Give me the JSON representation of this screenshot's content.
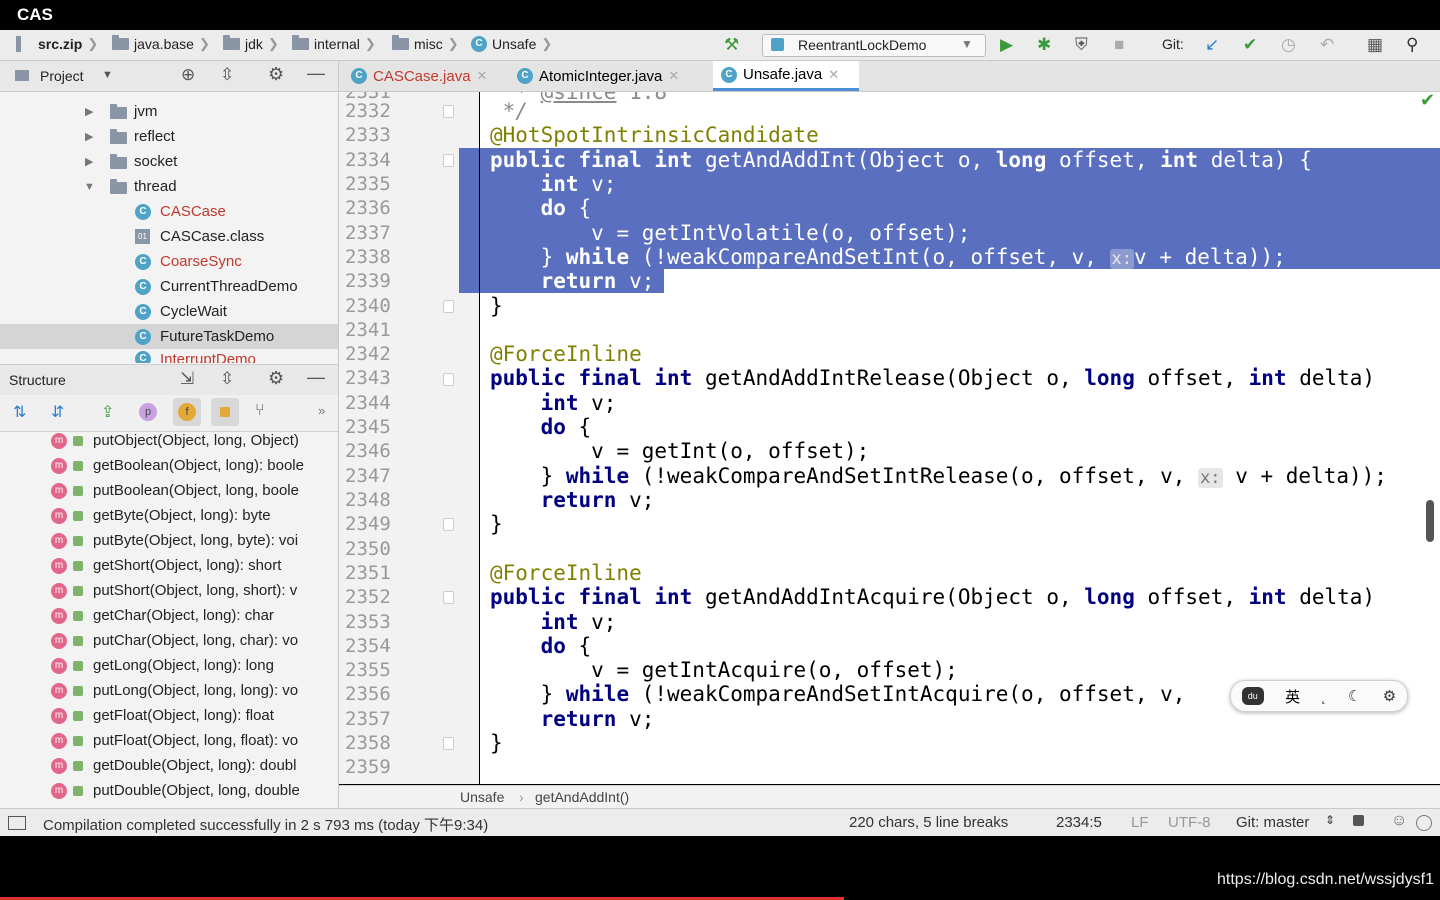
{
  "window": {
    "title": "CAS"
  },
  "nav": {
    "crumbs": [
      "src.zip",
      "java.base",
      "jdk",
      "internal",
      "misc",
      "Unsafe"
    ],
    "run_config": "ReentrantLockDemo",
    "git_label": "Git:"
  },
  "project_panel": {
    "title": "Project",
    "tree": [
      {
        "label": "jvm",
        "type": "folder",
        "expanded": false
      },
      {
        "label": "reflect",
        "type": "folder",
        "expanded": false
      },
      {
        "label": "socket",
        "type": "folder",
        "expanded": false
      },
      {
        "label": "thread",
        "type": "folder",
        "expanded": true
      },
      {
        "label": "CASCase",
        "type": "class",
        "color": "#c0392b"
      },
      {
        "label": "CASCase.class",
        "type": "classfile"
      },
      {
        "label": "CoarseSync",
        "type": "class",
        "color": "#c0392b"
      },
      {
        "label": "CurrentThreadDemo",
        "type": "class"
      },
      {
        "label": "CycleWait",
        "type": "class"
      },
      {
        "label": "FutureTaskDemo",
        "type": "class",
        "selected": true
      },
      {
        "label": "InterruptDemo",
        "type": "class",
        "color": "#c0392b"
      }
    ]
  },
  "structure_panel": {
    "title": "Structure",
    "items": [
      "putObject(Object, long, Object)",
      "getBoolean(Object, long): boole",
      "putBoolean(Object, long, boole",
      "getByte(Object, long): byte",
      "putByte(Object, long, byte): voi",
      "getShort(Object, long): short",
      "putShort(Object, long, short): v",
      "getChar(Object, long): char",
      "putChar(Object, long, char): vo",
      "getLong(Object, long): long",
      "putLong(Object, long, long): vo",
      "getFloat(Object, long): float",
      "putFloat(Object, long, float): vo",
      "getDouble(Object, long): doubl",
      "putDouble(Object, long, double"
    ]
  },
  "tabs": [
    {
      "label": "CASCase.java",
      "color": "#c0392b",
      "active": false
    },
    {
      "label": "AtomicInteger.java",
      "color": "#222",
      "active": false
    },
    {
      "label": "Unsafe.java",
      "color": "#222",
      "active": true
    }
  ],
  "editor": {
    "line_numbers": [
      "2331",
      "2332",
      "2333",
      "2334",
      "2335",
      "2336",
      "2337",
      "2338",
      "2339",
      "2340",
      "2341",
      "2342",
      "2343",
      "2344",
      "2345",
      "2346",
      "2347",
      "2348",
      "2349",
      "2350",
      "2351",
      "2352",
      "2353",
      "2354",
      "2355",
      "2356",
      "2357",
      "2358",
      "2359"
    ],
    "annotation_hotspot": "@HotSpotIntrinsicCandidate",
    "annotation_force": "@ForceInline",
    "comment_end": " */",
    "kw_public": "public",
    "kw_final": "final",
    "kw_int": "int",
    "kw_long": "long",
    "kw_do": "do",
    "kw_while": "while",
    "kw_return": "return",
    "m1_name": " getAndAddInt(Object o, ",
    "m2_name": " getAndAddIntRelease(Object o, ",
    "m3_name": " getAndAddIntAcquire(Object o, ",
    "offset_part": " offset, ",
    "delta_part": " delta) {",
    "delta_part_cut": " delta)",
    "v_decl": " v;",
    "brace_open": " {",
    "brace_close": "}",
    "m1_body": "v = getIntVolatile(o, offset);",
    "m2_body": "v = getInt(o, offset);",
    "m3_body": "v = getIntAcquire(o, offset);",
    "m1_while": " (!weakCompareAndSetInt(o, offset, v, ",
    "m2_while": " (!weakCompareAndSetIntRelease(o, offset, v, ",
    "m3_while": " (!weakCompareAndSetIntAcquire(o, offset, v,",
    "param_hint": "x:",
    "while_tail": "v + delta));",
    "m3_tail": "));",
    "return_v": " v;"
  },
  "breadcrumb": [
    "Unsafe",
    "getAndAddInt()"
  ],
  "status": {
    "message": "Compilation completed successfully in 2 s 793 ms (today 下午9:34)",
    "selection": "220 chars, 5 line breaks",
    "position": "2334:5",
    "line_sep": "LF",
    "encoding": "UTF-8",
    "git_branch": "Git: master"
  },
  "ime": {
    "en_cn": "英"
  },
  "watermark": "https://blog.csdn.net/wssjdysf1",
  "colors": {
    "selection": "#5a6fbf",
    "keyword": "#000080",
    "annotation": "#808000"
  }
}
